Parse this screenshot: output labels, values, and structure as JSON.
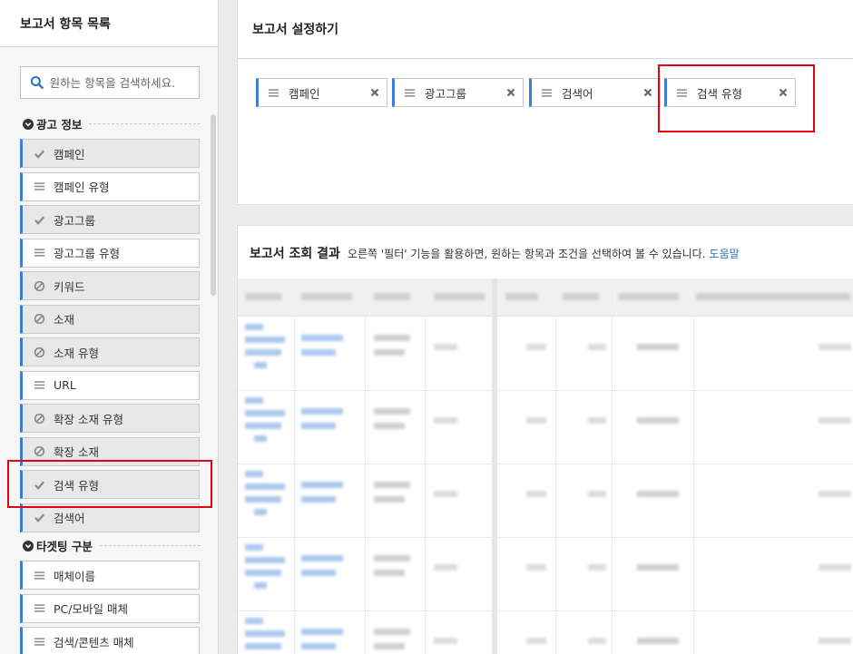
{
  "left_panel": {
    "title": "보고서 항목 목록",
    "search": {
      "placeholder": "원하는 항목을 검색하세요."
    },
    "groups": [
      {
        "title": "광고 정보",
        "items": [
          {
            "label": "캠페인",
            "state": "selected"
          },
          {
            "label": "캠페인 유형",
            "state": "available"
          },
          {
            "label": "광고그룹",
            "state": "selected"
          },
          {
            "label": "광고그룹 유형",
            "state": "available"
          },
          {
            "label": "키워드",
            "state": "disabled"
          },
          {
            "label": "소재",
            "state": "disabled"
          },
          {
            "label": "소재 유형",
            "state": "disabled"
          },
          {
            "label": "URL",
            "state": "available"
          },
          {
            "label": "확장 소재 유형",
            "state": "disabled"
          },
          {
            "label": "확장 소재",
            "state": "disabled"
          },
          {
            "label": "검색 유형",
            "state": "selected"
          },
          {
            "label": "검색어",
            "state": "selected"
          }
        ]
      },
      {
        "title": "타겟팅 구분",
        "items": [
          {
            "label": "매체이름",
            "state": "available"
          },
          {
            "label": "PC/모바일 매체",
            "state": "available"
          },
          {
            "label": "검색/콘텐츠 매체",
            "state": "available"
          }
        ]
      }
    ]
  },
  "config_panel": {
    "title": "보고서 설정하기",
    "chips": [
      {
        "label": "캠페인"
      },
      {
        "label": "광고그룹"
      },
      {
        "label": "검색어"
      },
      {
        "label": "검색 유형"
      }
    ]
  },
  "result_panel": {
    "title": "보고서 조회 결과",
    "description": "오른쪽 '필터' 기능을 활용하면, 원하는 항목과 조건을 선택하여 볼 수 있습니다.",
    "help_link": "도움말"
  },
  "colors": {
    "accent": "#3b7fd4",
    "highlight": "#e60012",
    "link": "#2a6fc4"
  }
}
